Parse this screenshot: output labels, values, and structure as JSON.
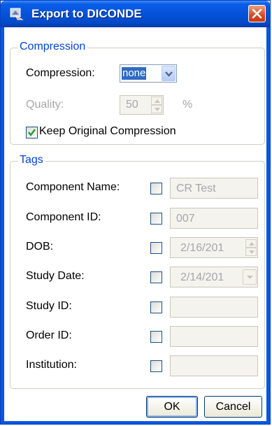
{
  "window": {
    "title": "Export to DICONDE",
    "app_icon": "export-icon",
    "close_icon": "close-icon",
    "accent_color": "#0552d9"
  },
  "compression": {
    "group_label": "Compression",
    "compression_label": "Compression:",
    "compression_value": "none",
    "quality_label": "Quality:",
    "quality_value": "50",
    "quality_unit": "%",
    "keep_original_label": "Keep Original Compression",
    "keep_original_checked": true
  },
  "tags": {
    "group_label": "Tags",
    "rows": [
      {
        "label": "Component Name:",
        "value": "CR Test",
        "checked": false,
        "kind": "text"
      },
      {
        "label": "Component ID:",
        "value": "007",
        "checked": false,
        "kind": "text"
      },
      {
        "label": "DOB:",
        "value": "2/16/201",
        "checked": false,
        "kind": "spin"
      },
      {
        "label": "Study Date:",
        "value": "2/14/201",
        "checked": false,
        "kind": "dropdown"
      },
      {
        "label": "Study ID:",
        "value": "",
        "checked": false,
        "kind": "text"
      },
      {
        "label": "Order ID:",
        "value": "",
        "checked": false,
        "kind": "text"
      },
      {
        "label": "Institution:",
        "value": "",
        "checked": false,
        "kind": "text"
      }
    ]
  },
  "buttons": {
    "ok_label": "OK",
    "cancel_label": "Cancel"
  }
}
